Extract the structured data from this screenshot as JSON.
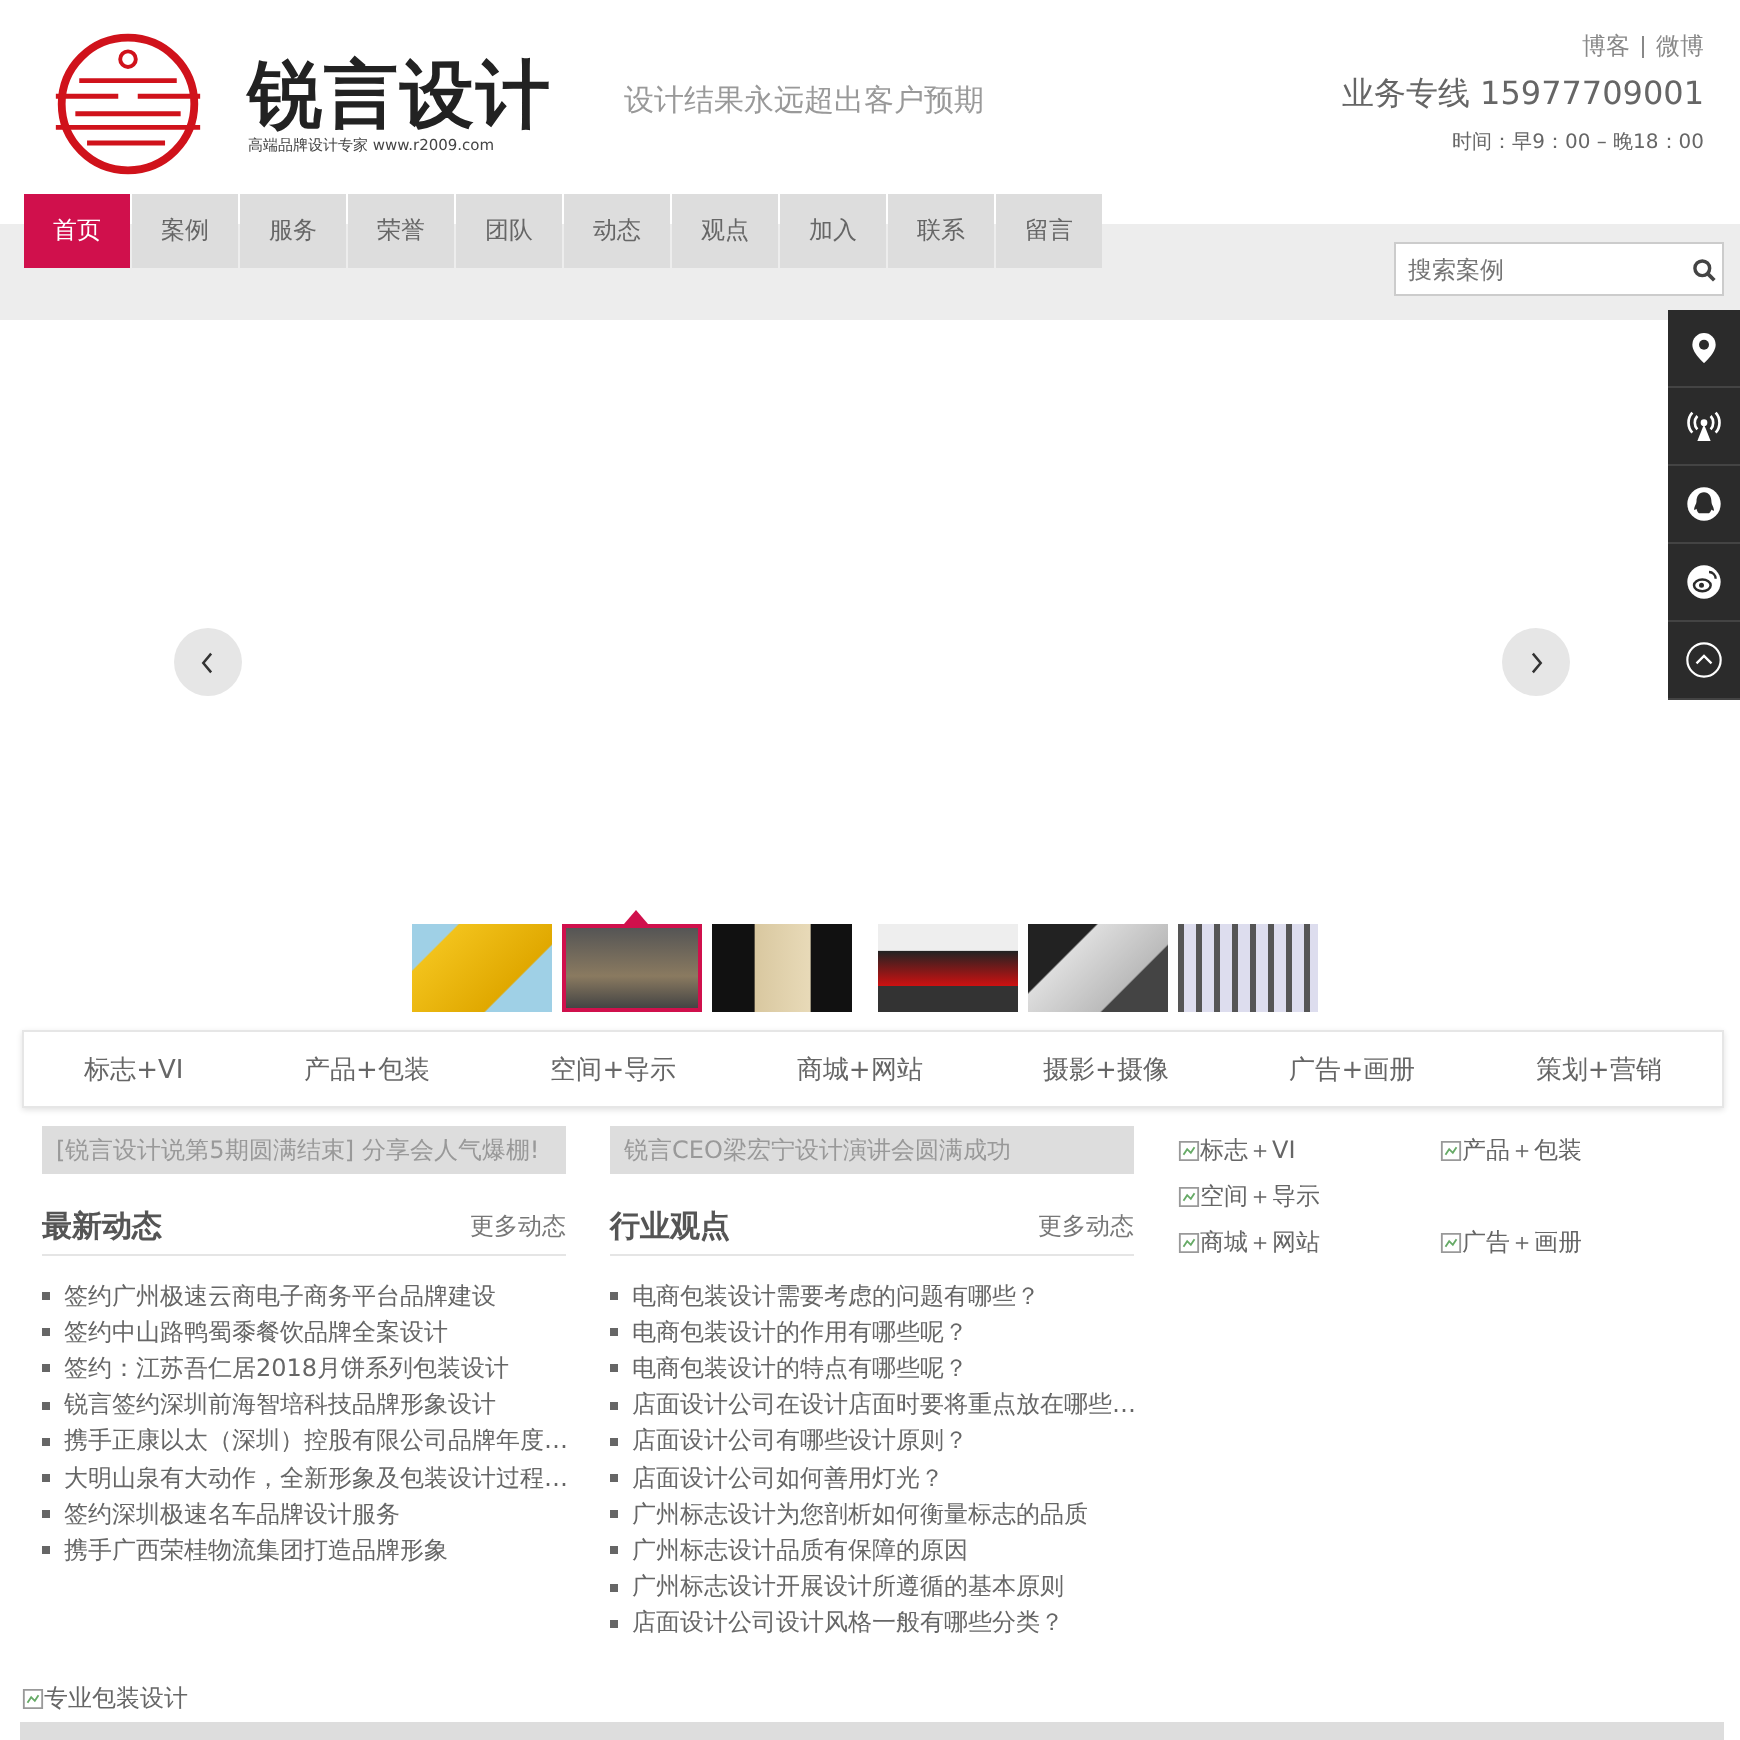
{
  "header": {
    "logo_name": "锐言设计",
    "logo_tagline": "高端品牌设计专家 www.r2009.com",
    "slogan": "设计结果永远超出客户预期",
    "links": [
      "博客",
      "微博"
    ],
    "hotline": "业务专线 15977709001",
    "hours": "时间：早9：00 – 晚18：00"
  },
  "nav": [
    {
      "label": "首页",
      "selected": true
    },
    {
      "label": "案例",
      "selected": false
    },
    {
      "label": "服务",
      "selected": false
    },
    {
      "label": "荣誉",
      "selected": false
    },
    {
      "label": "团队",
      "selected": false
    },
    {
      "label": "动态",
      "selected": false
    },
    {
      "label": "观点",
      "selected": false
    },
    {
      "label": "加入",
      "selected": false
    },
    {
      "label": "联系",
      "selected": false
    },
    {
      "label": "留言",
      "selected": false
    }
  ],
  "search": {
    "placeholder": "搜索案例"
  },
  "side_tools": [
    {
      "kind": "location"
    },
    {
      "kind": "signal"
    },
    {
      "kind": "qq"
    },
    {
      "kind": "weibo"
    },
    {
      "kind": "top"
    }
  ],
  "thumbnails": [
    {
      "selected": false
    },
    {
      "selected": true
    },
    {
      "selected": false
    },
    {
      "selected": false
    },
    {
      "selected": false
    },
    {
      "selected": false
    }
  ],
  "categories": [
    "标志+VI",
    "产品+包装",
    "空间+导示",
    "商城+网站",
    "摄影+摄像",
    "广告+画册",
    "策划+营销"
  ],
  "columns": [
    {
      "banner": "[锐言设计说第5期圆满结束] 分享会人气爆棚!",
      "title": "最新动态",
      "more": "更多动态",
      "items": [
        "签约广州极速云商电子商务平台品牌建设",
        "签约中山路鸭蜀黍餐饮品牌全案设计",
        "签约：江苏吾仁居2018月饼系列包装设计",
        "锐言签约深圳前海智培科技品牌形象设计",
        "携手正康以太（深圳）控股有限公司品牌年度…",
        "大明山泉有大动作，全新形象及包装设计过程…",
        "签约深圳极速名车品牌设计服务",
        "携手广西荣桂物流集团打造品牌形象"
      ]
    },
    {
      "banner": "锐言CEO梁宏宁设计演讲会圆满成功",
      "title": "行业观点",
      "more": "更多动态",
      "items": [
        "电商包装设计需要考虑的问题有哪些？",
        "电商包装设计的作用有哪些呢？",
        "电商包装设计的特点有哪些呢？",
        "店面设计公司在设计店面时要将重点放在哪些…",
        "店面设计公司有哪些设计原则？",
        "店面设计公司如何善用灯光？",
        "广州标志设计为您剖析如何衡量标志的品质",
        "广州标志设计品质有保障的原因",
        "广州标志设计开展设计所遵循的基本原则",
        "店面设计公司设计风格一般有哪些分类？"
      ]
    }
  ],
  "image_links": [
    [
      "标志＋VI",
      "产品＋包装"
    ],
    [
      "空间＋导示"
    ],
    [
      "商城＋网站",
      "广告＋画册"
    ]
  ],
  "banner_image": "专业包装设计"
}
